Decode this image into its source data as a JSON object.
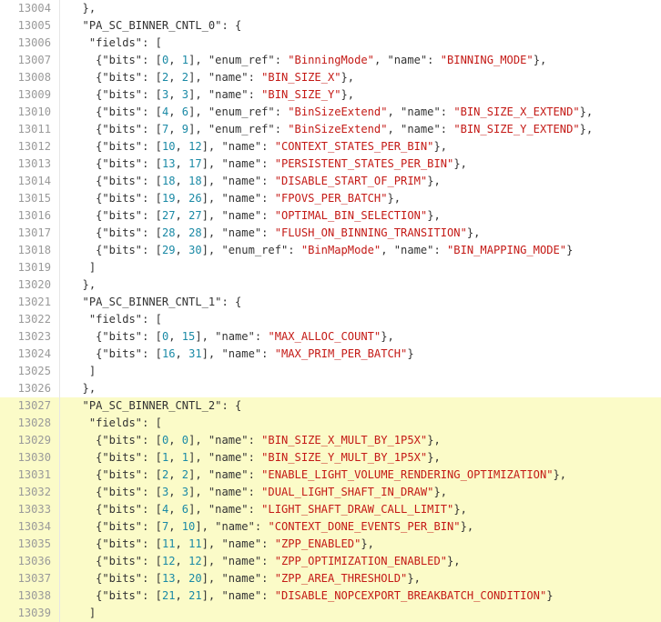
{
  "lines": [
    {
      "num": "13004",
      "hl": false,
      "tokens": [
        {
          "t": "p",
          "v": "  },"
        }
      ]
    },
    {
      "num": "13005",
      "hl": false,
      "tokens": [
        {
          "t": "p",
          "v": "  \"PA_SC_BINNER_CNTL_0\": {"
        }
      ]
    },
    {
      "num": "13006",
      "hl": false,
      "tokens": [
        {
          "t": "p",
          "v": "   \"fields\": ["
        }
      ]
    },
    {
      "num": "13007",
      "hl": false,
      "tokens": [
        {
          "t": "p",
          "v": "    {\"bits\": ["
        },
        {
          "t": "n",
          "v": "0"
        },
        {
          "t": "p",
          "v": ", "
        },
        {
          "t": "n",
          "v": "1"
        },
        {
          "t": "p",
          "v": "], \"enum_ref\": "
        },
        {
          "t": "s",
          "v": "\"BinningMode\""
        },
        {
          "t": "p",
          "v": ", \"name\": "
        },
        {
          "t": "s",
          "v": "\"BINNING_MODE\""
        },
        {
          "t": "p",
          "v": "},"
        }
      ]
    },
    {
      "num": "13008",
      "hl": false,
      "tokens": [
        {
          "t": "p",
          "v": "    {\"bits\": ["
        },
        {
          "t": "n",
          "v": "2"
        },
        {
          "t": "p",
          "v": ", "
        },
        {
          "t": "n",
          "v": "2"
        },
        {
          "t": "p",
          "v": "], \"name\": "
        },
        {
          "t": "s",
          "v": "\"BIN_SIZE_X\""
        },
        {
          "t": "p",
          "v": "},"
        }
      ]
    },
    {
      "num": "13009",
      "hl": false,
      "tokens": [
        {
          "t": "p",
          "v": "    {\"bits\": ["
        },
        {
          "t": "n",
          "v": "3"
        },
        {
          "t": "p",
          "v": ", "
        },
        {
          "t": "n",
          "v": "3"
        },
        {
          "t": "p",
          "v": "], \"name\": "
        },
        {
          "t": "s",
          "v": "\"BIN_SIZE_Y\""
        },
        {
          "t": "p",
          "v": "},"
        }
      ]
    },
    {
      "num": "13010",
      "hl": false,
      "tokens": [
        {
          "t": "p",
          "v": "    {\"bits\": ["
        },
        {
          "t": "n",
          "v": "4"
        },
        {
          "t": "p",
          "v": ", "
        },
        {
          "t": "n",
          "v": "6"
        },
        {
          "t": "p",
          "v": "], \"enum_ref\": "
        },
        {
          "t": "s",
          "v": "\"BinSizeExtend\""
        },
        {
          "t": "p",
          "v": ", \"name\": "
        },
        {
          "t": "s",
          "v": "\"BIN_SIZE_X_EXTEND\""
        },
        {
          "t": "p",
          "v": "},"
        }
      ]
    },
    {
      "num": "13011",
      "hl": false,
      "tokens": [
        {
          "t": "p",
          "v": "    {\"bits\": ["
        },
        {
          "t": "n",
          "v": "7"
        },
        {
          "t": "p",
          "v": ", "
        },
        {
          "t": "n",
          "v": "9"
        },
        {
          "t": "p",
          "v": "], \"enum_ref\": "
        },
        {
          "t": "s",
          "v": "\"BinSizeExtend\""
        },
        {
          "t": "p",
          "v": ", \"name\": "
        },
        {
          "t": "s",
          "v": "\"BIN_SIZE_Y_EXTEND\""
        },
        {
          "t": "p",
          "v": "},"
        }
      ]
    },
    {
      "num": "13012",
      "hl": false,
      "tokens": [
        {
          "t": "p",
          "v": "    {\"bits\": ["
        },
        {
          "t": "n",
          "v": "10"
        },
        {
          "t": "p",
          "v": ", "
        },
        {
          "t": "n",
          "v": "12"
        },
        {
          "t": "p",
          "v": "], \"name\": "
        },
        {
          "t": "s",
          "v": "\"CONTEXT_STATES_PER_BIN\""
        },
        {
          "t": "p",
          "v": "},"
        }
      ]
    },
    {
      "num": "13013",
      "hl": false,
      "tokens": [
        {
          "t": "p",
          "v": "    {\"bits\": ["
        },
        {
          "t": "n",
          "v": "13"
        },
        {
          "t": "p",
          "v": ", "
        },
        {
          "t": "n",
          "v": "17"
        },
        {
          "t": "p",
          "v": "], \"name\": "
        },
        {
          "t": "s",
          "v": "\"PERSISTENT_STATES_PER_BIN\""
        },
        {
          "t": "p",
          "v": "},"
        }
      ]
    },
    {
      "num": "13014",
      "hl": false,
      "tokens": [
        {
          "t": "p",
          "v": "    {\"bits\": ["
        },
        {
          "t": "n",
          "v": "18"
        },
        {
          "t": "p",
          "v": ", "
        },
        {
          "t": "n",
          "v": "18"
        },
        {
          "t": "p",
          "v": "], \"name\": "
        },
        {
          "t": "s",
          "v": "\"DISABLE_START_OF_PRIM\""
        },
        {
          "t": "p",
          "v": "},"
        }
      ]
    },
    {
      "num": "13015",
      "hl": false,
      "tokens": [
        {
          "t": "p",
          "v": "    {\"bits\": ["
        },
        {
          "t": "n",
          "v": "19"
        },
        {
          "t": "p",
          "v": ", "
        },
        {
          "t": "n",
          "v": "26"
        },
        {
          "t": "p",
          "v": "], \"name\": "
        },
        {
          "t": "s",
          "v": "\"FPOVS_PER_BATCH\""
        },
        {
          "t": "p",
          "v": "},"
        }
      ]
    },
    {
      "num": "13016",
      "hl": false,
      "tokens": [
        {
          "t": "p",
          "v": "    {\"bits\": ["
        },
        {
          "t": "n",
          "v": "27"
        },
        {
          "t": "p",
          "v": ", "
        },
        {
          "t": "n",
          "v": "27"
        },
        {
          "t": "p",
          "v": "], \"name\": "
        },
        {
          "t": "s",
          "v": "\"OPTIMAL_BIN_SELECTION\""
        },
        {
          "t": "p",
          "v": "},"
        }
      ]
    },
    {
      "num": "13017",
      "hl": false,
      "tokens": [
        {
          "t": "p",
          "v": "    {\"bits\": ["
        },
        {
          "t": "n",
          "v": "28"
        },
        {
          "t": "p",
          "v": ", "
        },
        {
          "t": "n",
          "v": "28"
        },
        {
          "t": "p",
          "v": "], \"name\": "
        },
        {
          "t": "s",
          "v": "\"FLUSH_ON_BINNING_TRANSITION\""
        },
        {
          "t": "p",
          "v": "},"
        }
      ]
    },
    {
      "num": "13018",
      "hl": false,
      "tokens": [
        {
          "t": "p",
          "v": "    {\"bits\": ["
        },
        {
          "t": "n",
          "v": "29"
        },
        {
          "t": "p",
          "v": ", "
        },
        {
          "t": "n",
          "v": "30"
        },
        {
          "t": "p",
          "v": "], \"enum_ref\": "
        },
        {
          "t": "s",
          "v": "\"BinMapMode\""
        },
        {
          "t": "p",
          "v": ", \"name\": "
        },
        {
          "t": "s",
          "v": "\"BIN_MAPPING_MODE\""
        },
        {
          "t": "p",
          "v": "}"
        }
      ]
    },
    {
      "num": "13019",
      "hl": false,
      "tokens": [
        {
          "t": "p",
          "v": "   ]"
        }
      ]
    },
    {
      "num": "13020",
      "hl": false,
      "tokens": [
        {
          "t": "p",
          "v": "  },"
        }
      ]
    },
    {
      "num": "13021",
      "hl": false,
      "tokens": [
        {
          "t": "p",
          "v": "  \"PA_SC_BINNER_CNTL_1\": {"
        }
      ]
    },
    {
      "num": "13022",
      "hl": false,
      "tokens": [
        {
          "t": "p",
          "v": "   \"fields\": ["
        }
      ]
    },
    {
      "num": "13023",
      "hl": false,
      "tokens": [
        {
          "t": "p",
          "v": "    {\"bits\": ["
        },
        {
          "t": "n",
          "v": "0"
        },
        {
          "t": "p",
          "v": ", "
        },
        {
          "t": "n",
          "v": "15"
        },
        {
          "t": "p",
          "v": "], \"name\": "
        },
        {
          "t": "s",
          "v": "\"MAX_ALLOC_COUNT\""
        },
        {
          "t": "p",
          "v": "},"
        }
      ]
    },
    {
      "num": "13024",
      "hl": false,
      "tokens": [
        {
          "t": "p",
          "v": "    {\"bits\": ["
        },
        {
          "t": "n",
          "v": "16"
        },
        {
          "t": "p",
          "v": ", "
        },
        {
          "t": "n",
          "v": "31"
        },
        {
          "t": "p",
          "v": "], \"name\": "
        },
        {
          "t": "s",
          "v": "\"MAX_PRIM_PER_BATCH\""
        },
        {
          "t": "p",
          "v": "}"
        }
      ]
    },
    {
      "num": "13025",
      "hl": false,
      "tokens": [
        {
          "t": "p",
          "v": "   ]"
        }
      ]
    },
    {
      "num": "13026",
      "hl": false,
      "tokens": [
        {
          "t": "p",
          "v": "  },"
        }
      ]
    },
    {
      "num": "13027",
      "hl": true,
      "tokens": [
        {
          "t": "p",
          "v": "  \"PA_SC_BINNER_CNTL_2\": {"
        }
      ]
    },
    {
      "num": "13028",
      "hl": true,
      "tokens": [
        {
          "t": "p",
          "v": "   \"fields\": ["
        }
      ]
    },
    {
      "num": "13029",
      "hl": true,
      "tokens": [
        {
          "t": "p",
          "v": "    {\"bits\": ["
        },
        {
          "t": "n",
          "v": "0"
        },
        {
          "t": "p",
          "v": ", "
        },
        {
          "t": "n",
          "v": "0"
        },
        {
          "t": "p",
          "v": "], \"name\": "
        },
        {
          "t": "s",
          "v": "\"BIN_SIZE_X_MULT_BY_1P5X\""
        },
        {
          "t": "p",
          "v": "},"
        }
      ]
    },
    {
      "num": "13030",
      "hl": true,
      "tokens": [
        {
          "t": "p",
          "v": "    {\"bits\": ["
        },
        {
          "t": "n",
          "v": "1"
        },
        {
          "t": "p",
          "v": ", "
        },
        {
          "t": "n",
          "v": "1"
        },
        {
          "t": "p",
          "v": "], \"name\": "
        },
        {
          "t": "s",
          "v": "\"BIN_SIZE_Y_MULT_BY_1P5X\""
        },
        {
          "t": "p",
          "v": "},"
        }
      ]
    },
    {
      "num": "13031",
      "hl": true,
      "tokens": [
        {
          "t": "p",
          "v": "    {\"bits\": ["
        },
        {
          "t": "n",
          "v": "2"
        },
        {
          "t": "p",
          "v": ", "
        },
        {
          "t": "n",
          "v": "2"
        },
        {
          "t": "p",
          "v": "], \"name\": "
        },
        {
          "t": "s",
          "v": "\"ENABLE_LIGHT_VOLUME_RENDERING_OPTIMIZATION\""
        },
        {
          "t": "p",
          "v": "},"
        }
      ]
    },
    {
      "num": "13032",
      "hl": true,
      "tokens": [
        {
          "t": "p",
          "v": "    {\"bits\": ["
        },
        {
          "t": "n",
          "v": "3"
        },
        {
          "t": "p",
          "v": ", "
        },
        {
          "t": "n",
          "v": "3"
        },
        {
          "t": "p",
          "v": "], \"name\": "
        },
        {
          "t": "s",
          "v": "\"DUAL_LIGHT_SHAFT_IN_DRAW\""
        },
        {
          "t": "p",
          "v": "},"
        }
      ]
    },
    {
      "num": "13033",
      "hl": true,
      "tokens": [
        {
          "t": "p",
          "v": "    {\"bits\": ["
        },
        {
          "t": "n",
          "v": "4"
        },
        {
          "t": "p",
          "v": ", "
        },
        {
          "t": "n",
          "v": "6"
        },
        {
          "t": "p",
          "v": "], \"name\": "
        },
        {
          "t": "s",
          "v": "\"LIGHT_SHAFT_DRAW_CALL_LIMIT\""
        },
        {
          "t": "p",
          "v": "},"
        }
      ]
    },
    {
      "num": "13034",
      "hl": true,
      "tokens": [
        {
          "t": "p",
          "v": "    {\"bits\": ["
        },
        {
          "t": "n",
          "v": "7"
        },
        {
          "t": "p",
          "v": ", "
        },
        {
          "t": "n",
          "v": "10"
        },
        {
          "t": "p",
          "v": "], \"name\": "
        },
        {
          "t": "s",
          "v": "\"CONTEXT_DONE_EVENTS_PER_BIN\""
        },
        {
          "t": "p",
          "v": "},"
        }
      ]
    },
    {
      "num": "13035",
      "hl": true,
      "tokens": [
        {
          "t": "p",
          "v": "    {\"bits\": ["
        },
        {
          "t": "n",
          "v": "11"
        },
        {
          "t": "p",
          "v": ", "
        },
        {
          "t": "n",
          "v": "11"
        },
        {
          "t": "p",
          "v": "], \"name\": "
        },
        {
          "t": "s",
          "v": "\"ZPP_ENABLED\""
        },
        {
          "t": "p",
          "v": "},"
        }
      ]
    },
    {
      "num": "13036",
      "hl": true,
      "tokens": [
        {
          "t": "p",
          "v": "    {\"bits\": ["
        },
        {
          "t": "n",
          "v": "12"
        },
        {
          "t": "p",
          "v": ", "
        },
        {
          "t": "n",
          "v": "12"
        },
        {
          "t": "p",
          "v": "], \"name\": "
        },
        {
          "t": "s",
          "v": "\"ZPP_OPTIMIZATION_ENABLED\""
        },
        {
          "t": "p",
          "v": "},"
        }
      ]
    },
    {
      "num": "13037",
      "hl": true,
      "tokens": [
        {
          "t": "p",
          "v": "    {\"bits\": ["
        },
        {
          "t": "n",
          "v": "13"
        },
        {
          "t": "p",
          "v": ", "
        },
        {
          "t": "n",
          "v": "20"
        },
        {
          "t": "p",
          "v": "], \"name\": "
        },
        {
          "t": "s",
          "v": "\"ZPP_AREA_THRESHOLD\""
        },
        {
          "t": "p",
          "v": "},"
        }
      ]
    },
    {
      "num": "13038",
      "hl": true,
      "tokens": [
        {
          "t": "p",
          "v": "    {\"bits\": ["
        },
        {
          "t": "n",
          "v": "21"
        },
        {
          "t": "p",
          "v": ", "
        },
        {
          "t": "n",
          "v": "21"
        },
        {
          "t": "p",
          "v": "], \"name\": "
        },
        {
          "t": "s",
          "v": "\"DISABLE_NOPCEXPORT_BREAKBATCH_CONDITION\""
        },
        {
          "t": "p",
          "v": "}"
        }
      ]
    },
    {
      "num": "13039",
      "hl": true,
      "tokens": [
        {
          "t": "p",
          "v": "   ]"
        }
      ]
    }
  ]
}
